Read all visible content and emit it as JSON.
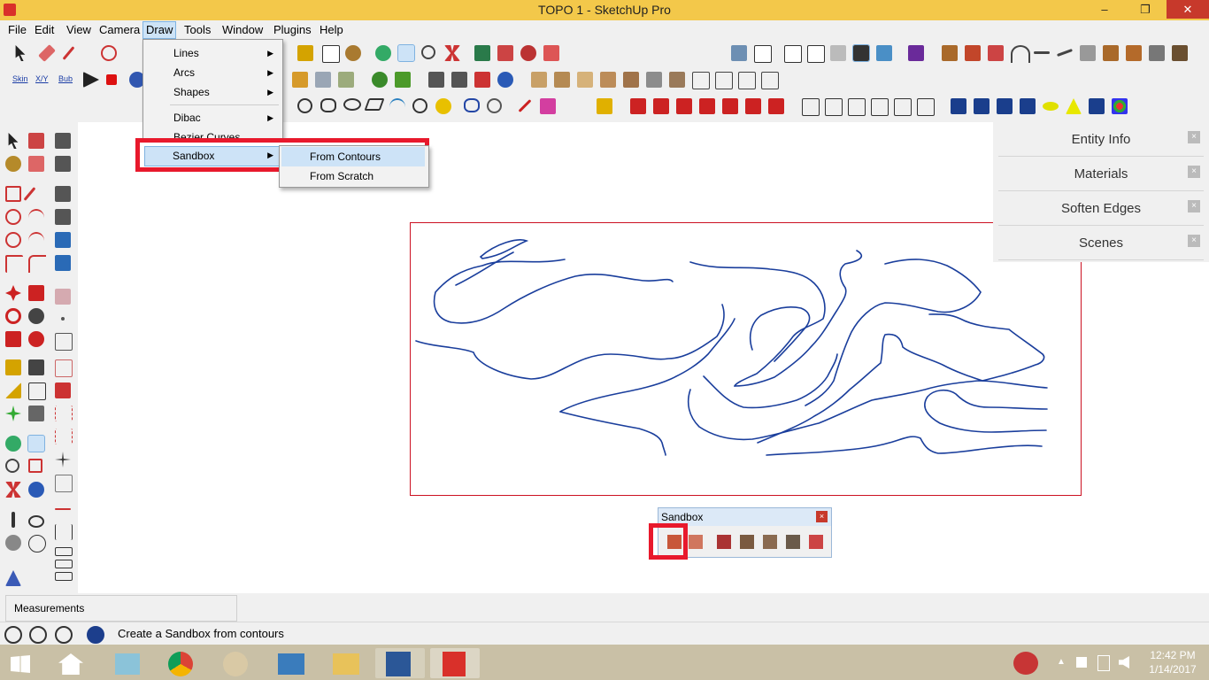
{
  "app": {
    "title": "TOPO 1 - SketchUp Pro"
  },
  "window_controls": {
    "minimize": "–",
    "restore": "❐",
    "close": "✕"
  },
  "menubar": {
    "items": [
      {
        "label": "File"
      },
      {
        "label": "Edit"
      },
      {
        "label": "View"
      },
      {
        "label": "Camera"
      },
      {
        "label": "Draw"
      },
      {
        "label": "Tools"
      },
      {
        "label": "Window"
      },
      {
        "label": "Plugins"
      },
      {
        "label": "Help"
      }
    ],
    "active": "Draw"
  },
  "toolbar_labels": {
    "skin": "Skin",
    "xyz": "X/Y",
    "bub": "Bub"
  },
  "draw_menu": {
    "items": [
      {
        "label": "Lines",
        "submenu": true
      },
      {
        "label": "Arcs",
        "submenu": true
      },
      {
        "label": "Shapes",
        "submenu": true
      },
      {
        "label": "Dibac",
        "submenu": true
      },
      {
        "label": "Bezier Curves",
        "submenu": false
      },
      {
        "label": "Sandbox",
        "submenu": true,
        "highlighted": true
      }
    ]
  },
  "sandbox_submenu": {
    "items": [
      {
        "label": "From Contours",
        "highlighted": true
      },
      {
        "label": "From Scratch"
      }
    ]
  },
  "tray": {
    "panels": [
      {
        "label": "Entity Info"
      },
      {
        "label": "Materials"
      },
      {
        "label": "Soften Edges"
      },
      {
        "label": "Scenes"
      }
    ],
    "close_glyph": "×"
  },
  "sandbox_toolbar": {
    "title": "Sandbox",
    "close": "×"
  },
  "measurements": {
    "label": "Measurements"
  },
  "status": {
    "message": "Create a Sandbox from contours"
  },
  "taskbar": {
    "time": "12:42 PM",
    "date": "1/14/2017"
  },
  "colors": {
    "title_bar": "#f3c84a",
    "highlight_box": "#e8192c",
    "contour_lines": "#1a3e9c",
    "selection": "#cc1122"
  }
}
